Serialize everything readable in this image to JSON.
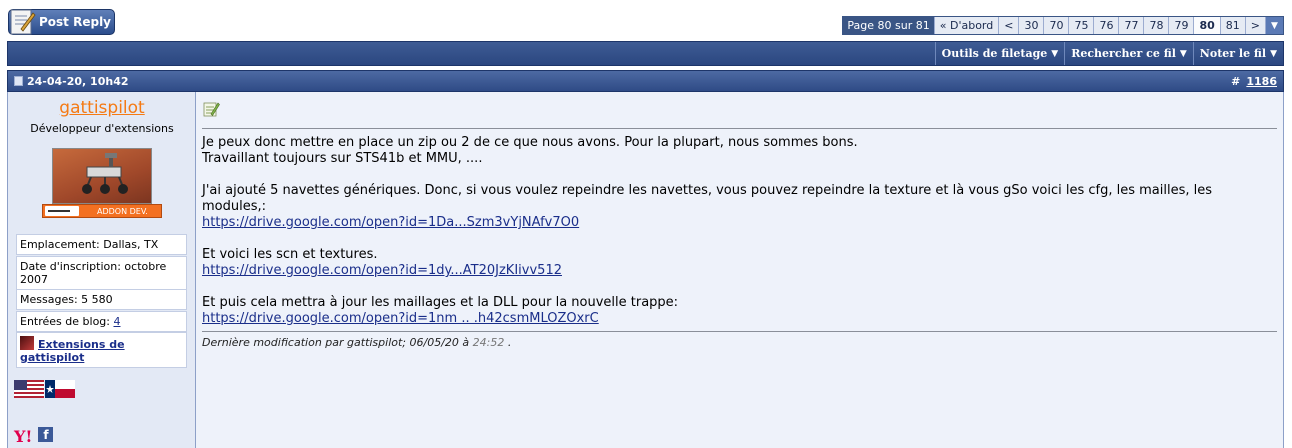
{
  "toolbar_top": {
    "post_reply": "Post Reply"
  },
  "pager": {
    "label": "Page 80 sur 81",
    "first": "« D'abord",
    "prev": "<",
    "pages": [
      "30",
      "70",
      "75",
      "76",
      "77",
      "78",
      "79",
      "80",
      "81"
    ],
    "current": "80",
    "next": ">"
  },
  "thread_tools": {
    "tools": "Outils de filetage",
    "search": "Rechercher ce fil",
    "rate": "Noter le fil"
  },
  "post": {
    "date": "24-04-20, 10h42",
    "hash": "#",
    "number": "1186",
    "user": {
      "name": "gattispilot",
      "title": "Développeur d'extensions",
      "badge": "ADDON DEV.",
      "location": "Emplacement: Dallas, TX",
      "join_date": "Date d'inscription: octobre 2007",
      "messages": "Messages: 5 580",
      "blog_label": "Entrées de blog: ",
      "blog_count": "4",
      "blog_link": "Extensions de gattispilot"
    },
    "message": {
      "line1": "Je peux donc mettre en place un zip ou 2 de ce que nous avons. Pour la plupart, nous sommes bons.",
      "line2": "Travaillant toujours sur STS41b et MMU, ....",
      "line3": "J'ai ajouté 5 navettes génériques. Donc, si vous voulez repeindre les navettes, vous pouvez repeindre la texture et là vous gSo voici les cfg, les mailles, les modules,:",
      "link1": "https://drive.google.com/open?id=1Da...Szm3vYjNAfv7O0",
      "line4": "Et voici les scn et textures.",
      "link2": "https://drive.google.com/open?id=1dy...AT20JzKIivv512",
      "line5": "Et puis cela mettra à jour les maillages et la DLL pour la nouvelle trappe:",
      "link3": "https://drive.google.com/open?id=1nm .. .h42csmMLOZOxrC"
    },
    "edit": {
      "text": "Dernière modification par gattispilot; 06/05/20 à ",
      "time": "24:52",
      "end": " ."
    }
  },
  "colors": {
    "header_blue": "#2f4b86",
    "username_orange": "#f57a14",
    "link_blue": "#1a2e8a"
  }
}
